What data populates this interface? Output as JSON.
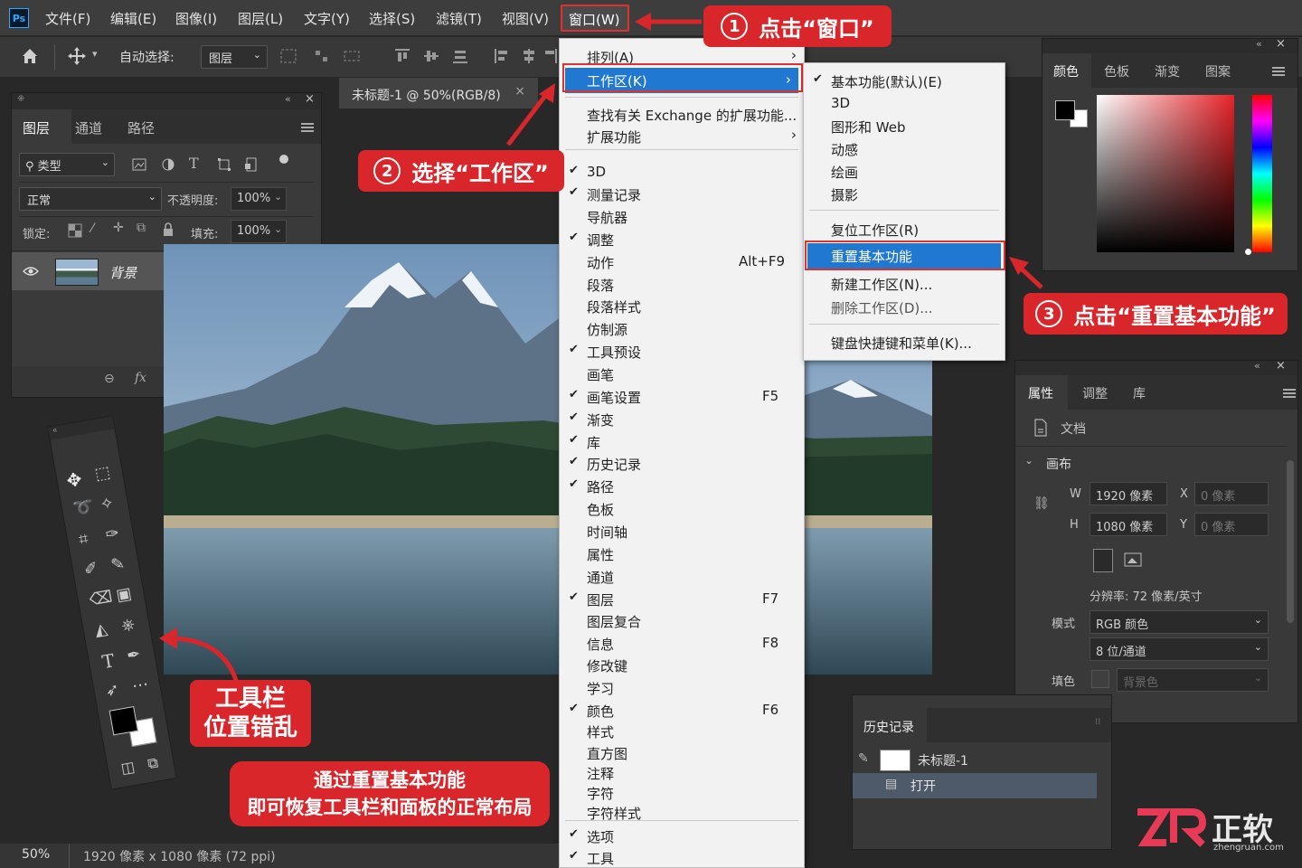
{
  "app": {
    "logo": "Ps"
  },
  "menubar": {
    "items": [
      "文件(F)",
      "编辑(E)",
      "图像(I)",
      "图层(L)",
      "文字(Y)",
      "选择(S)",
      "滤镜(T)",
      "视图(V)",
      "窗口(W)"
    ]
  },
  "options_bar": {
    "label": "自动选择:",
    "target_value": "图层"
  },
  "document_tab": {
    "title": "未标题-1 @ 50%(RGB/8)",
    "close": "×"
  },
  "layers_panel": {
    "tabs": [
      "图层",
      "通道",
      "路径"
    ],
    "filter_label": "类型",
    "blend_mode": "正常",
    "opacity_label": "不透明度:",
    "opacity_value": "100%",
    "lock_label": "锁定:",
    "fill_label": "填充:",
    "fill_value": "100%",
    "layer_name": "背景"
  },
  "window_menu": {
    "items": [
      {
        "label": "排列(A)",
        "submenu": true
      },
      {
        "label": "工作区(K)",
        "submenu": true,
        "highlighted": true
      },
      {
        "label": "查找有关 Exchange 的扩展功能..."
      },
      {
        "label": "扩展功能",
        "submenu": true
      },
      {
        "label": "3D",
        "checked": true
      },
      {
        "label": "测量记录",
        "checked": true
      },
      {
        "label": "导航器"
      },
      {
        "label": "调整",
        "checked": true
      },
      {
        "label": "动作",
        "shortcut": "Alt+F9"
      },
      {
        "label": "段落"
      },
      {
        "label": "段落样式"
      },
      {
        "label": "仿制源"
      },
      {
        "label": "工具预设",
        "checked": true
      },
      {
        "label": "画笔"
      },
      {
        "label": "画笔设置",
        "checked": true,
        "shortcut": "F5"
      },
      {
        "label": "渐变",
        "checked": true
      },
      {
        "label": "库",
        "checked": true
      },
      {
        "label": "历史记录",
        "checked": true
      },
      {
        "label": "路径",
        "checked": true
      },
      {
        "label": "色板"
      },
      {
        "label": "时间轴"
      },
      {
        "label": "属性"
      },
      {
        "label": "通道"
      },
      {
        "label": "图层",
        "checked": true,
        "shortcut": "F7"
      },
      {
        "label": "图层复合"
      },
      {
        "label": "信息",
        "shortcut": "F8"
      },
      {
        "label": "修改键"
      },
      {
        "label": "学习"
      },
      {
        "label": "颜色",
        "checked": true,
        "shortcut": "F6"
      },
      {
        "label": "样式"
      },
      {
        "label": "直方图"
      },
      {
        "label": "注释"
      },
      {
        "label": "字符"
      },
      {
        "label": "字符样式"
      },
      {
        "label": "选项",
        "checked": true
      },
      {
        "label": "工具",
        "checked": true
      }
    ]
  },
  "workspace_submenu": {
    "items": [
      {
        "label": "基本功能(默认)(E)",
        "checked": true
      },
      {
        "label": "3D"
      },
      {
        "label": "图形和 Web"
      },
      {
        "label": "动感"
      },
      {
        "label": "绘画"
      },
      {
        "label": "摄影"
      },
      {
        "label": "复位工作区(R)"
      },
      {
        "label": "重置基本功能",
        "highlighted": true
      },
      {
        "label": "新建工作区(N)..."
      },
      {
        "label": "删除工作区(D)..."
      },
      {
        "label": "键盘快捷键和菜单(K)..."
      }
    ]
  },
  "color_panel": {
    "tabs": [
      "颜色",
      "色板",
      "渐变",
      "图案"
    ]
  },
  "properties_panel": {
    "tabs": [
      "属性",
      "调整",
      "库"
    ],
    "doc_label": "文档",
    "section": "画布",
    "w_label": "W",
    "w_value": "1920 像素",
    "h_label": "H",
    "h_value": "1080 像素",
    "x_label": "X",
    "x_value": "0 像素",
    "y_label": "Y",
    "y_value": "0 像素",
    "resolution": "分辨率: 72 像素/英寸",
    "mode_label": "模式",
    "mode_value": "RGB 颜色",
    "depth_value": "8 位/通道",
    "fill_label": "填色",
    "fill_value": "背景色"
  },
  "history_panel": {
    "title": "历史记录",
    "snapshot": "未标题-1",
    "step": "打开"
  },
  "status_bar": {
    "zoom": "50%",
    "info": "1920 像素 x 1080 像素 (72 ppi)"
  },
  "callouts": {
    "step1": {
      "num": "1",
      "text": "点击“窗口”"
    },
    "step2": {
      "num": "2",
      "text": "选择“工作区”"
    },
    "step3": {
      "num": "3",
      "text": "点击“重置基本功能”"
    },
    "toolbar_line1": "工具栏",
    "toolbar_line2": "位置错乱",
    "bottom_line1": "通过重置基本功能",
    "bottom_line2": "即可恢复工具栏和面板的正常布局"
  },
  "watermark": {
    "brand": "正软",
    "site": "zhengruan.com"
  },
  "colors": {
    "accent_red": "#d9262b",
    "menu_highlight": "#2178d1",
    "ps_blue": "#31a8ff"
  }
}
